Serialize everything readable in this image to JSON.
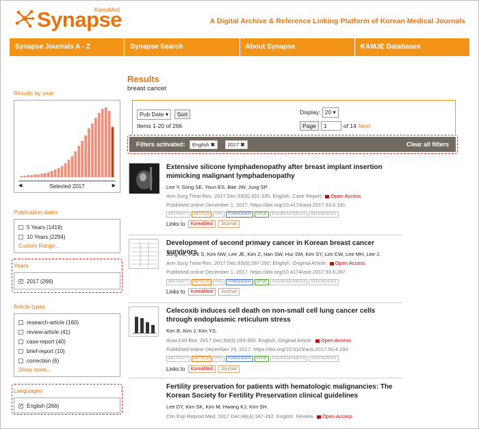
{
  "brand": {
    "name": "Synapse",
    "sub": "KoreaMed",
    "tagline": "A Digital Archive & Reference Linking Platform of Korean Medical Journals",
    "color": "#e8720c"
  },
  "nav": {
    "items": [
      "Synapse Journals  A - Z",
      "Synapse Search",
      "About Synapse",
      "KAMJE Databases"
    ]
  },
  "results": {
    "title": "Results",
    "query": "breast cancer"
  },
  "controls": {
    "sort_select": "Pub Date",
    "sort_button": "Sort",
    "display_label": "Display:",
    "display_value": "20",
    "items_text": "Items 1-20 of 266",
    "page_button": "Page",
    "page_value": "1",
    "of_text": "of 14",
    "next": "Next"
  },
  "filters": {
    "label": "Filters activated:",
    "tags": [
      "English",
      "2017"
    ],
    "clear": "Clear all filters"
  },
  "sidebar": {
    "by_year": {
      "title": "Results by year",
      "selected": "Selected 2017",
      "bar_levels": [
        0.02,
        0.02,
        0.03,
        0.03,
        0.04,
        0.04,
        0.05,
        0.06,
        0.07,
        0.09,
        0.11,
        0.13,
        0.16,
        0.2,
        0.25,
        0.3,
        0.37,
        0.45,
        0.52,
        0.6,
        0.7,
        0.77,
        0.85,
        0.92,
        0.98,
        1.0,
        0.95,
        0.72
      ]
    },
    "pub_dates": {
      "title": "Publication dates",
      "items": [
        "5 Years (1419)",
        "10 Years (2294)"
      ],
      "more": "Custom Range..."
    },
    "years": {
      "title": "Years",
      "items": [
        "2017 (266)"
      ]
    },
    "article_types": {
      "title": "Article types",
      "items": [
        "research-article (160)",
        "review-article (41)",
        "case-report (40)",
        "brief-report (10)",
        "correction (6)"
      ],
      "more": "Show more..."
    },
    "languages": {
      "title": "Languages",
      "items": [
        "English (266)"
      ]
    }
  },
  "formats": [
    "ABSTRACT",
    "ARTICLE",
    "PDF",
    "PUBREADER",
    "EPUB",
    "FIGURES&TABLES",
    "REFERENCES"
  ],
  "links_label": "Links to",
  "link_koreamed": "KoreaMed",
  "link_journal": "Journal",
  "open_access": "Open Access",
  "articles": [
    {
      "title": "Extensive silicone lymphadenopathy after breast implant insertion mimicking malignant lymphadenopathy",
      "authors": "Lee Y, Song SE, Youn ES, Bae JW, Jung SP.",
      "citation": "Ann Surg Treat Res. 2017 Dec;93(6):331-335. English. Case Report.",
      "published": "Published online December 1, 2017. https://doi.org/10.4174/astr.2017.93.6.331"
    },
    {
      "title": "Development of second primary cancer in Korean breast cancer survivors",
      "authors": "Jung HK, Park S, Kim NW, Lee JE, Kim Z, Han SW, Hur SM, Kim SY, Lim CW, Lee MH, Lee J.",
      "citation": "Ann Surg Treat Res. 2017 Dec;93(6):287-292. English. Original Article.",
      "published": "Published online December 1, 2017. https://doi.org/10.4174/astr.2017.93.6.287"
    },
    {
      "title": "Celecoxib induces cell death on non-small cell lung cancer cells through endoplasmic reticulum stress",
      "authors": "Kim B, Kim J, Kim YS.",
      "citation": "Anat Cell Biol. 2017 Dec;50(4):293-300. English. Original Article.",
      "published": "Published online December 29, 2017. https://doi.org/10.5115/acb.2017.50.4.293"
    },
    {
      "title": "Fertility preservation for patients with hematologic malignancies: The Korean Society for Fertility Preservation clinical guidelines",
      "authors": "Lee DY, Kim SK, Kim M, Hwang KJ, Kim SH.",
      "citation": "Clin Exp Reprod Med. 2017 Dec;44(4):187-192. English. Review."
    }
  ]
}
